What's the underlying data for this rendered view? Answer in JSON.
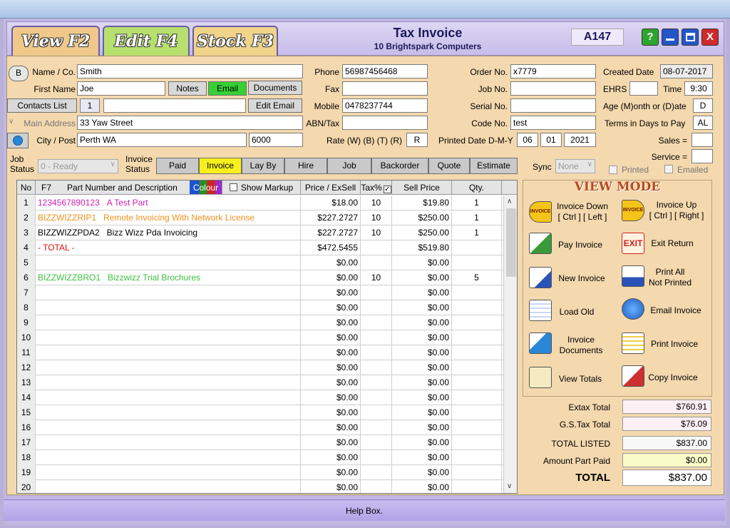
{
  "header": {
    "title": "Tax Invoice",
    "subtitle": "10 Brightspark Computers",
    "invoice_no": "A147"
  },
  "tabs": {
    "view": "View F2",
    "edit": "Edit F4",
    "stock": "Stock F3"
  },
  "win": {
    "help": "?",
    "close": "X"
  },
  "customer": {
    "name_label": "Name / Co.",
    "name": "Smith",
    "first_label": "First Name",
    "first": "Joe",
    "notes": "Notes",
    "email_btn": "Email",
    "documents": "Documents",
    "contacts_list": "Contacts List",
    "contacts_count": "1",
    "edit_email": "Edit Email",
    "address_label": "Main Address",
    "address": "33 Yaw Street",
    "city_label": "City / Post",
    "city": "Perth WA",
    "post": "6000",
    "b_btn": "B"
  },
  "contact": {
    "phone_label": "Phone",
    "phone": "56987456468",
    "fax_label": "Fax",
    "fax": "",
    "mobile_label": "Mobile",
    "mobile": "0478237744",
    "abn_label": "ABN/Tax",
    "abn": "",
    "rate_label": "Rate (W)  (B)  (T)  (R)",
    "rate": "R"
  },
  "order": {
    "order_label": "Order No.",
    "order": "x7779",
    "job_label": "Job No.",
    "job": "",
    "serial_label": "Serial No.",
    "serial": "",
    "code_label": "Code No.",
    "code": "test",
    "printed_label": "Printed Date D-M-Y",
    "pd_d": "06",
    "pd_m": "01",
    "pd_y": "2021"
  },
  "side": {
    "created_label": "Created Date",
    "created": "08-07-2017",
    "ehrs_label": "EHRS",
    "ehrs": "",
    "time_label": "Time",
    "time": "9:30",
    "age_label": "Age (M)onth or (D)ate",
    "age": "D",
    "terms_label": "Terms in Days to Pay",
    "terms": "AL",
    "sales_label": "Sales =",
    "sales": "",
    "service_label": "Service =",
    "service": "",
    "sync_label": "Sync",
    "sync": "None",
    "printed": "Printed",
    "emailed": "Emailed"
  },
  "status": {
    "job_label": "Job Status",
    "job_value": "0 - Ready",
    "invoice_label": "Invoice Status",
    "buttons": [
      "Paid",
      "Invoice",
      "Lay By",
      "Hire",
      "Job",
      "Backorder",
      "Quote",
      "Estimate"
    ]
  },
  "grid": {
    "headers": {
      "no": "No",
      "f7": "F7",
      "part": "Part Number and Description",
      "colour": "Colour",
      "markup": "Show Markup",
      "price": "Price / ExSell",
      "tax": "Tax%",
      "sell": "Sell Price",
      "qty": "Qty."
    },
    "rows": [
      {
        "no": "1",
        "part": "1234567890123",
        "desc": "A Test Part",
        "price": "$18.00",
        "tax": "10",
        "sell": "$19.80",
        "qty": "1",
        "color": "#d01fb5"
      },
      {
        "no": "2",
        "part": "BIZZWIZZRIP1",
        "desc": "Remote Invoicing With Network License",
        "price": "$227.2727",
        "tax": "10",
        "sell": "$250.00",
        "qty": "1",
        "color": "#f0901e"
      },
      {
        "no": "3",
        "part": "BIZZWIZZPDA2",
        "desc": "Bizz Wizz Pda Invoicing",
        "price": "$227.2727",
        "tax": "10",
        "sell": "$250.00",
        "qty": "1",
        "color": "#000000"
      },
      {
        "no": "4",
        "part": "- TOTAL -",
        "desc": "",
        "price": "$472.5455",
        "tax": "",
        "sell": "$519.80",
        "qty": "",
        "color": "#e01010"
      },
      {
        "no": "5",
        "part": "",
        "desc": "",
        "price": "$0.00",
        "tax": "",
        "sell": "$0.00",
        "qty": "",
        "color": "#000000"
      },
      {
        "no": "6",
        "part": "BIZZWIZZBRO1",
        "desc": "Bizzwizz Trial Brochures",
        "price": "$0.00",
        "tax": "10",
        "sell": "$0.00",
        "qty": "5",
        "color": "#3fbf3f"
      },
      {
        "no": "7",
        "part": "",
        "desc": "",
        "price": "$0.00",
        "tax": "",
        "sell": "$0.00",
        "qty": "",
        "color": "#000000"
      },
      {
        "no": "8",
        "part": "",
        "desc": "",
        "price": "$0.00",
        "tax": "",
        "sell": "$0.00",
        "qty": "",
        "color": "#000000"
      },
      {
        "no": "9",
        "part": "",
        "desc": "",
        "price": "$0.00",
        "tax": "",
        "sell": "$0.00",
        "qty": "",
        "color": "#000000"
      },
      {
        "no": "10",
        "part": "",
        "desc": "",
        "price": "$0.00",
        "tax": "",
        "sell": "$0.00",
        "qty": "",
        "color": "#000000"
      },
      {
        "no": "11",
        "part": "",
        "desc": "",
        "price": "$0.00",
        "tax": "",
        "sell": "$0.00",
        "qty": "",
        "color": "#000000"
      },
      {
        "no": "12",
        "part": "",
        "desc": "",
        "price": "$0.00",
        "tax": "",
        "sell": "$0.00",
        "qty": "",
        "color": "#000000"
      },
      {
        "no": "13",
        "part": "",
        "desc": "",
        "price": "$0.00",
        "tax": "",
        "sell": "$0.00",
        "qty": "",
        "color": "#000000"
      },
      {
        "no": "14",
        "part": "",
        "desc": "",
        "price": "$0.00",
        "tax": "",
        "sell": "$0.00",
        "qty": "",
        "color": "#000000"
      },
      {
        "no": "15",
        "part": "",
        "desc": "",
        "price": "$0.00",
        "tax": "",
        "sell": "$0.00",
        "qty": "",
        "color": "#000000"
      },
      {
        "no": "16",
        "part": "",
        "desc": "",
        "price": "$0.00",
        "tax": "",
        "sell": "$0.00",
        "qty": "",
        "color": "#000000"
      },
      {
        "no": "17",
        "part": "",
        "desc": "",
        "price": "$0.00",
        "tax": "",
        "sell": "$0.00",
        "qty": "",
        "color": "#000000"
      },
      {
        "no": "18",
        "part": "",
        "desc": "",
        "price": "$0.00",
        "tax": "",
        "sell": "$0.00",
        "qty": "",
        "color": "#000000"
      },
      {
        "no": "19",
        "part": "",
        "desc": "",
        "price": "$0.00",
        "tax": "",
        "sell": "$0.00",
        "qty": "",
        "color": "#000000"
      },
      {
        "no": "20",
        "part": "",
        "desc": "",
        "price": "$0.00",
        "tax": "",
        "sell": "$0.00",
        "qty": "",
        "color": "#000000"
      }
    ]
  },
  "viewmode": {
    "title": "VIEW MODE",
    "inv_down": "Invoice Down",
    "inv_down_k": "[ Ctrl ] [ Left ]",
    "inv_up": "Invoice Up",
    "inv_up_k": "[ Ctrl ] [ Right ]",
    "pay": "Pay Invoice",
    "exit": "Exit Return",
    "new": "New Invoice",
    "print_all": "Print All",
    "not_printed": "Not Printed",
    "load_old": "Load Old",
    "email_inv": "Email Invoice",
    "inv_docs": "Invoice",
    "inv_docs2": "Documents",
    "print_inv": "Print Invoice",
    "view_totals": "View Totals",
    "copy_inv": "Copy Invoice",
    "icon_invoice": "INVOICE",
    "icon_exit": "EXIT"
  },
  "totals": {
    "extax_label": "Extax Total",
    "extax": "$760.91",
    "gst_label": "G.S.Tax Total",
    "gst": "$76.09",
    "listed_label": "TOTAL LISTED",
    "listed": "$837.00",
    "paid_label": "Amount Part Paid",
    "paid": "$0.00",
    "total_label": "TOTAL",
    "total": "$837.00"
  },
  "help": "Help Box."
}
